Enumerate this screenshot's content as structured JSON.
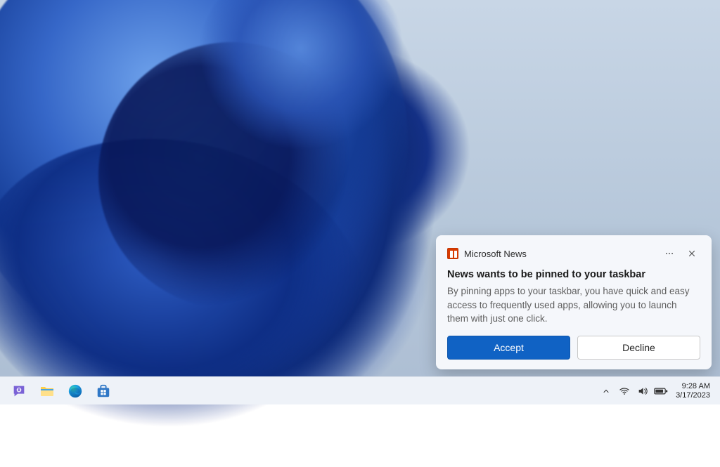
{
  "notification": {
    "app_name": "Microsoft News",
    "title": "News wants to be pinned to your taskbar",
    "body": "By pinning apps to your taskbar, you have quick and easy access to frequently used apps, allowing you to launch them with just one click.",
    "accept_label": "Accept",
    "decline_label": "Decline"
  },
  "taskbar": {
    "icons": {
      "chat": "chat-icon",
      "file_explorer": "file-explorer-icon",
      "edge": "edge-icon",
      "store": "microsoft-store-icon"
    }
  },
  "systray": {
    "time": "9:28 AM",
    "date": "3/17/2023"
  }
}
